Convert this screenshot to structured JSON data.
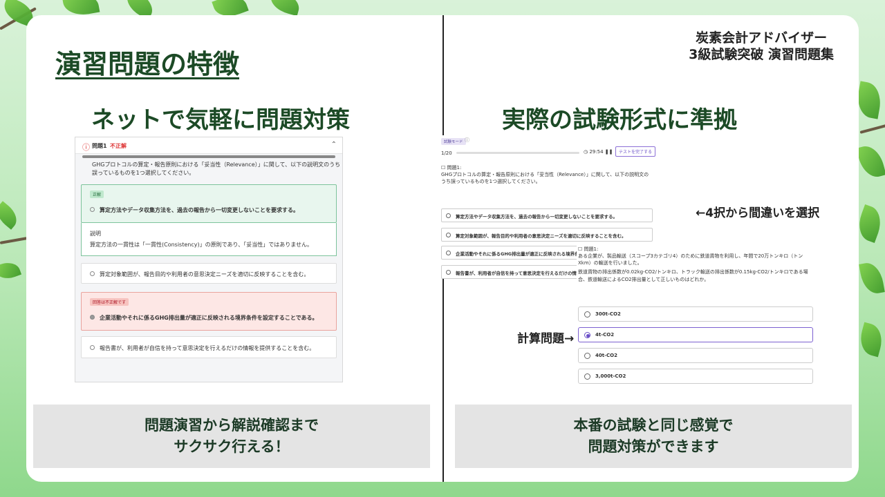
{
  "main_title": "演習問題の特徴",
  "brand": {
    "line1": "炭素会計アドバイザー",
    "line2": "3級試験突破 演習問題集"
  },
  "left": {
    "heading": "ネットで気軽に問題対策",
    "caption_line1": "問題演習から解説確認まで",
    "caption_line2": "サクサク行える！",
    "screenshot": {
      "question_number": "問題1",
      "status": "不正解",
      "question": "GHGプロトコルの算定・報告原則における「妥当性（Relevance）」に関して、以下の説明文のうち誤っているものを1つ選択してください。",
      "correct_tag": "正解",
      "correct_option": "算定方法やデータ収集方法を、過去の報告から一切変更しないことを要求する。",
      "explain_label": "説明",
      "explain_text": "算定方法の一貫性は「一貫性(Consistency)」の原則であり、「妥当性」ではありません。",
      "option2": "算定対象範囲が、報告目的や利用者の意思決定ニーズを適切に反映することを含む。",
      "wrong_tag": "回答は不正解です",
      "wrong_option": "企業活動やそれに係るGHG排出量が適正に反映される境界条件を設定することである。",
      "option4": "報告書が、利用者が自信を持って意思決定を行えるだけの情報を提供することを含む。"
    }
  },
  "right": {
    "heading": "実際の試験形式に準拠",
    "caption_line1": "本番の試験と同じ感覚で",
    "caption_line2": "問題対策ができます",
    "annot_select": "←4択から間違いを選択",
    "annot_calc": "計算問題→",
    "screenshot_a": {
      "mode_badge": "試験モード",
      "progress": "1/20",
      "timer": "29:54",
      "finish_button": "テストを完了する",
      "question_label": "問題1:",
      "question": "GHGプロトコルの算定・報告原則における「妥当性（Relevance）」に関して、以下の説明文のうち誤っているものを1つ選択してください。",
      "options": [
        "算定方法やデータ収集方法を、過去の報告から一切変更しないことを要求する。",
        "算定対象範囲が、報告目的や利用者の意思決定ニーズを適切に反映することを含む。",
        "企業活動やそれに係るGHG排出量が適正に反映される境界条件を設定することである。",
        "報告書が、利用者が自信を持って意思決定を行えるだけの情"
      ]
    },
    "screenshot_b": {
      "question_label": "問題1:",
      "question1": "ある企業が、製品輸送（スコープ3カテゴリ4）のために鉄道貨物を利用し、年間で20万トンキロ（トンXkm）の輸送を行いました。",
      "question2": "鉄道貨物の排出係数が0.02kg-CO2/トンキロ、トラック輸送の排出係数が0.15kg-CO2/トンキロである場合、鉄道輸送によるCO2排出量として正しいものはどれか。",
      "options": [
        "300t-CO2",
        "4t-CO2",
        "40t-CO2",
        "3,000t-CO2"
      ],
      "selected_index": 1
    }
  }
}
